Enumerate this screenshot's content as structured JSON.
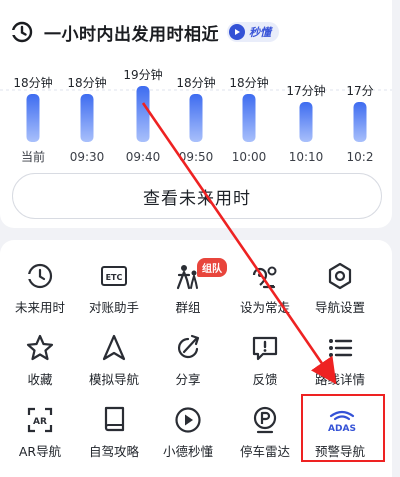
{
  "header": {
    "title": "一小时内出发用时相近",
    "badge_label": "秒懂"
  },
  "chart_data": {
    "type": "bar",
    "categories": [
      "当前",
      "09:30",
      "09:40",
      "09:50",
      "10:00",
      "10:10",
      "10:2"
    ],
    "values": [
      18,
      18,
      19,
      18,
      18,
      17,
      17
    ],
    "data_labels": [
      "18分钟",
      "18分钟",
      "19分钟",
      "18分钟",
      "18分钟",
      "17分钟",
      "17分"
    ],
    "unit": "分钟",
    "highlight_index": 2
  },
  "future_time_button": {
    "label": "查看未来用时"
  },
  "tools": {
    "badge_zudui": "组队",
    "items": [
      {
        "name": "future-time",
        "label": "未来用时",
        "icon": "clock-icon"
      },
      {
        "name": "etc-assistant",
        "label": "对账助手",
        "icon": "etc-icon"
      },
      {
        "name": "group",
        "label": "群组",
        "icon": "group-icon"
      },
      {
        "name": "set-frequent",
        "label": "设为常走",
        "icon": "route-icon"
      },
      {
        "name": "nav-settings",
        "label": "导航设置",
        "icon": "settings-icon"
      },
      {
        "name": "favorite",
        "label": "收藏",
        "icon": "star-icon"
      },
      {
        "name": "simulate-nav",
        "label": "模拟导航",
        "icon": "navigation-arrow-icon"
      },
      {
        "name": "share",
        "label": "分享",
        "icon": "share-icon"
      },
      {
        "name": "feedback",
        "label": "反馈",
        "icon": "feedback-icon"
      },
      {
        "name": "route-details",
        "label": "路线详情",
        "icon": "list-icon"
      },
      {
        "name": "ar-nav",
        "label": "AR导航",
        "icon": "ar-icon"
      },
      {
        "name": "drive-guide",
        "label": "自驾攻略",
        "icon": "book-icon"
      },
      {
        "name": "xiaode-explain",
        "label": "小德秒懂",
        "icon": "play-icon"
      },
      {
        "name": "parking-radar",
        "label": "停车雷达",
        "icon": "parking-icon"
      },
      {
        "name": "warning-nav",
        "label": "预警导航",
        "icon": "adas-icon"
      }
    ],
    "adas_text": "ADAS"
  },
  "colors": {
    "bar": "#3e6cf0",
    "bar_light": "#a9c0fb",
    "annotation": "#ee2222",
    "accent": "#3452d6"
  }
}
